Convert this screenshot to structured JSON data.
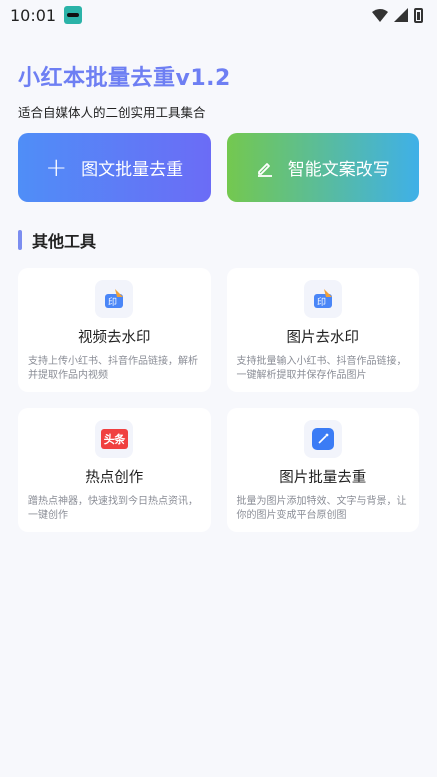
{
  "status": {
    "time": "10:01"
  },
  "header": {
    "title": "小红本批量去重v1.2",
    "subtitle": "适合自媒体人的二创实用工具集合"
  },
  "actions": {
    "batch_dedupe_label": "图文批量去重",
    "smart_rewrite_label": "智能文案改写"
  },
  "section": {
    "title": "其他工具"
  },
  "tools": [
    {
      "title": "视频去水印",
      "desc": "支持上传小红书、抖音作品链接，解析并提取作品内视频"
    },
    {
      "title": "图片去水印",
      "desc": "支持批量输入小红书、抖音作品链接，一键解析提取并保存作品图片"
    },
    {
      "title": "热点创作",
      "desc": "蹭热点神器，快速找到今日热点资讯，一键创作",
      "icon_text": "头条"
    },
    {
      "title": "图片批量去重",
      "desc": "批量为图片添加特效、文字与背景，让你的图片变成平台原创图"
    }
  ],
  "colors": {
    "accent": "#6e7ff3",
    "btn_blue_start": "#4f8ef7",
    "btn_blue_end": "#6b6cf6",
    "btn_green_start": "#74c84f",
    "btn_green_end": "#3fb0e8"
  },
  "icons": {
    "status": [
      "app-notification-icon",
      "wifi-icon",
      "signal-icon",
      "battery-icon"
    ],
    "actions": [
      "plus-icon",
      "pen-icon"
    ],
    "tools": [
      "watermark-stamp-icon",
      "watermark-stamp-icon",
      "toutiao-icon",
      "magic-wand-icon"
    ]
  }
}
